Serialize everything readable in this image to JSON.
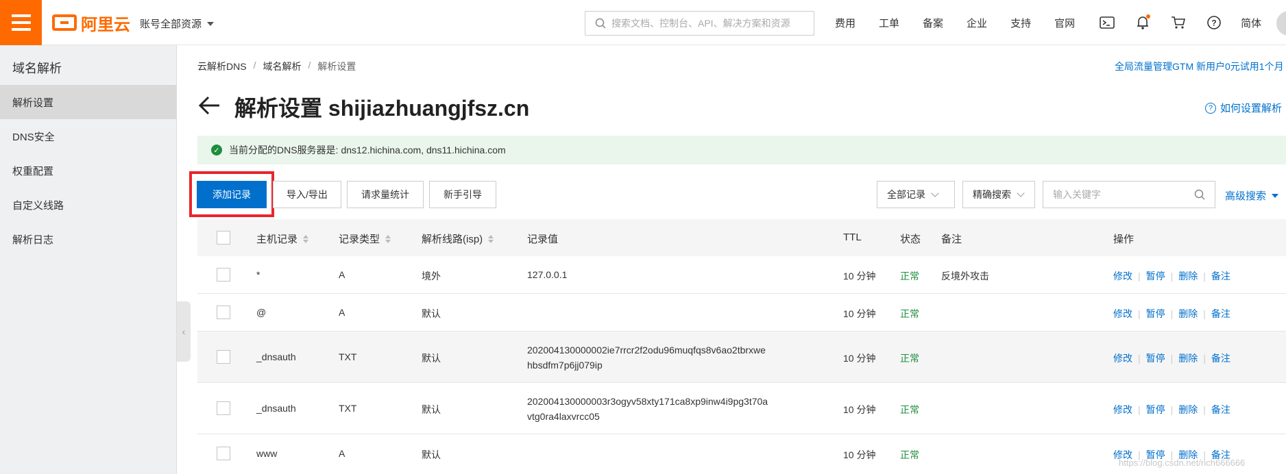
{
  "header": {
    "logo_text": "阿里云",
    "account_label": "账号全部资源",
    "search_placeholder": "搜索文档、控制台、API、解决方案和资源",
    "nav": [
      "费用",
      "工单",
      "备案",
      "企业",
      "支持",
      "官网"
    ],
    "lang": "简体",
    "icons": [
      "terminal-icon",
      "bell-icon",
      "cart-icon",
      "help-icon"
    ],
    "accent_color": "#ff6a00"
  },
  "sidebar": {
    "title": "域名解析",
    "items": [
      {
        "label": "解析设置",
        "active": true
      },
      {
        "label": "DNS安全",
        "active": false
      },
      {
        "label": "权重配置",
        "active": false
      },
      {
        "label": "自定义线路",
        "active": false
      },
      {
        "label": "解析日志",
        "active": false
      }
    ]
  },
  "breadcrumb": [
    "云解析DNS",
    "域名解析",
    "解析设置"
  ],
  "promo": "全局流量管理GTM 新用户0元试用1个月",
  "page_title": "解析设置 shijiazhuangjfsz.cn",
  "help_link": "如何设置解析",
  "notice": {
    "label": "当前分配的DNS服务器是:",
    "servers": "dns12.hichina.com, dns11.hichina.com"
  },
  "toolbar": {
    "add": "添加记录",
    "import_export": "导入/导出",
    "stats": "请求量统计",
    "guide": "新手引导",
    "filter_all": "全部记录",
    "exact_search": "精确搜索",
    "keyword_placeholder": "输入关键字",
    "advanced": "高级搜索"
  },
  "table": {
    "headers": {
      "host": "主机记录",
      "type": "记录类型",
      "line": "解析线路(isp)",
      "value": "记录值",
      "ttl": "TTL",
      "status": "状态",
      "remark": "备注",
      "ops": "操作"
    },
    "ops_labels": {
      "edit": "修改",
      "pause": "暂停",
      "delete": "删除",
      "remark": "备注"
    },
    "rows": [
      {
        "host": "*",
        "type": "A",
        "line": "境外",
        "value": "127.0.0.1",
        "value2": "",
        "ttl": "10 分钟",
        "status": "正常",
        "remark": "反境外攻击"
      },
      {
        "host": "@",
        "type": "A",
        "line": "默认",
        "value": "",
        "value2": "",
        "ttl": "10 分钟",
        "status": "正常",
        "remark": ""
      },
      {
        "host": "_dnsauth",
        "type": "TXT",
        "line": "默认",
        "value": "202004130000002ie7rrcr2f2odu96muqfqs8v6ao2tbrxwe",
        "value2": "hbsdfm7p6jj079ip",
        "ttl": "10 分钟",
        "status": "正常",
        "remark": ""
      },
      {
        "host": "_dnsauth",
        "type": "TXT",
        "line": "默认",
        "value": "202004130000003r3ogyv58xty171ca8xp9inw4i9pg3t70a",
        "value2": "vtg0ra4laxvrcc05",
        "ttl": "10 分钟",
        "status": "正常",
        "remark": ""
      },
      {
        "host": "www",
        "type": "A",
        "line": "默认",
        "value": "",
        "value2": "",
        "ttl": "10 分钟",
        "status": "正常",
        "remark": ""
      }
    ]
  },
  "watermark": "https://blog.csdn.net/rich666666",
  "colors": {
    "primary": "#0070cc",
    "success": "#1e8e3e",
    "highlight": "#e8262c"
  }
}
